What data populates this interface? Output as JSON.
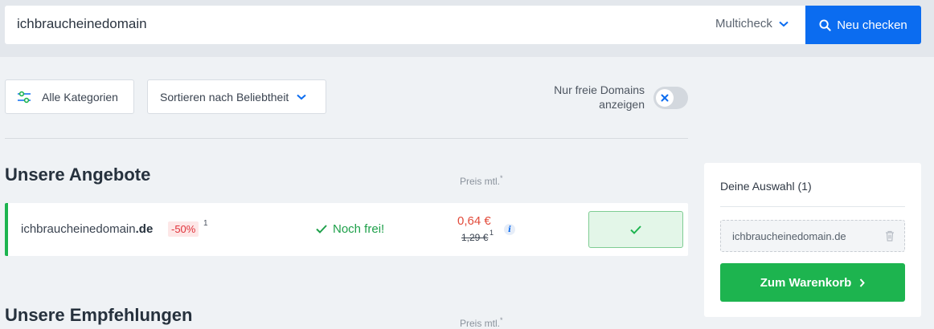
{
  "search": {
    "query": "ichbraucheinedomain",
    "mode_label": "Multicheck",
    "button_label": "Neu checken"
  },
  "filters": {
    "categories_label": "Alle Kategorien",
    "sort_label": "Sortieren nach Beliebtheit",
    "free_only_label_line1": "Nur freie Domains",
    "free_only_label_line2": "anzeigen",
    "free_only_enabled": false
  },
  "offers": {
    "heading": "Unsere Angebote",
    "price_header": "Preis mtl.",
    "price_header_mark": "*",
    "items": [
      {
        "domain_name": "ichbraucheinedomain",
        "tld": ".de",
        "discount": "-50%",
        "footnote": "1",
        "status": "Noch frei!",
        "price": "0,64 €",
        "old_price": "1,29 €",
        "old_price_footnote": "1",
        "info_icon": "i",
        "selected": true
      }
    ]
  },
  "recommendations": {
    "heading": "Unsere Empfehlungen",
    "price_header": "Preis mtl.",
    "price_header_mark": "*"
  },
  "cart": {
    "title": "Deine Auswahl (1)",
    "items": [
      {
        "domain": "ichbraucheinedomain.de"
      }
    ],
    "checkout_label": "Zum Warenkorb"
  },
  "colors": {
    "primary_blue": "#0b6cf0",
    "success_green": "#1db44f",
    "price_red": "#e24b3b"
  }
}
